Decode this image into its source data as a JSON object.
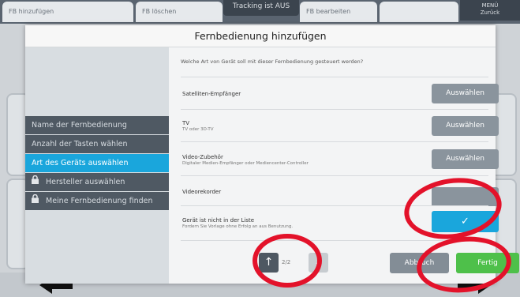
{
  "background": {
    "tabs": [
      "FB hinzufügen",
      "FB löschen",
      "FB bearbeiten"
    ],
    "tracking": "Tracking ist AUS",
    "menu": {
      "line1": "MENÜ",
      "line2": "Zurück"
    }
  },
  "modal": {
    "title": "Fernbedienung hinzufügen",
    "steps": [
      {
        "label": "Name der Fernbedienung",
        "state": "done"
      },
      {
        "label": "Anzahl der Tasten wählen",
        "state": "done"
      },
      {
        "label": "Art des Geräts auswählen",
        "state": "active"
      },
      {
        "label": "Hersteller auswählen",
        "state": "locked"
      },
      {
        "label": "Meine Fernbedienung finden",
        "state": "locked"
      }
    ],
    "question": "Welche Art von Gerät soll mit dieser Fernbedienung gesteuert werden?",
    "devices": [
      {
        "title": "Satelliten-Empfänger",
        "subtitle": "",
        "button": "Auswählen"
      },
      {
        "title": "TV",
        "subtitle": "TV oder 3D-TV",
        "button": "Auswählen"
      },
      {
        "title": "Video-Zubehör",
        "subtitle": "Digitaler Medien-Empfänger oder Mediencenter-Controller",
        "button": "Auswählen"
      },
      {
        "title": "Videorekorder",
        "subtitle": "",
        "button": ""
      },
      {
        "title": "Gerät ist nicht in der Liste",
        "subtitle": "Fordern Sie Vorlage ohne Erfolg an aus Benutzung.",
        "button": "✓"
      }
    ],
    "pager": {
      "up": "↑",
      "down": "↓",
      "page": "2/2"
    },
    "cancel": "Abbruch",
    "finish": "Fertig"
  },
  "colors": {
    "accent": "#1aa6dc",
    "finish": "#4ec04a",
    "annotation": "#e3122a"
  }
}
